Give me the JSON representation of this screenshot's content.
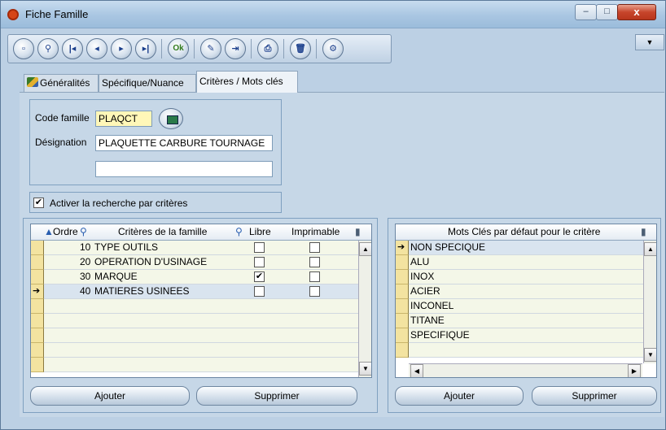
{
  "window": {
    "title": "Fiche Famille",
    "close_glyph": "x",
    "min_glyph": "–",
    "max_glyph": "□"
  },
  "toolbar": {
    "ok_label": "Ok",
    "buttons": [
      "new-icon",
      "search-icon",
      "first-icon",
      "previous-icon",
      "next-icon",
      "last-icon",
      "ok-icon",
      "edit-icon",
      "exit-icon",
      "print-icon",
      "delete-icon",
      "settings-icon"
    ],
    "menu_glyph": "▼"
  },
  "tabs": [
    "Généralités",
    "Spécifique/Nuance",
    "Critères / Mots clés"
  ],
  "form": {
    "code_label": "Code famille",
    "code_value": "PLAQCT",
    "designation_label": "Désignation",
    "designation_value": "PLAQUETTE CARBURE TOURNAGE",
    "extra_value": "",
    "search_checkbox_label": "Activer la recherche par critères",
    "search_checked": true
  },
  "criteria_grid": {
    "headers": {
      "order": "Ordre",
      "criteria": "Critères de la famille",
      "free": "Libre",
      "printable": "Imprimable"
    },
    "rows": [
      {
        "order": "10",
        "name": "TYPE OUTILS",
        "free": false,
        "printable": false
      },
      {
        "order": "20",
        "name": "OPERATION D'USINAGE",
        "free": false,
        "printable": false
      },
      {
        "order": "30",
        "name": "MARQUE",
        "free": true,
        "printable": false
      },
      {
        "order": "40",
        "name": "MATIERES USINEES",
        "free": false,
        "printable": false
      }
    ],
    "selected_row": 3,
    "add_label": "Ajouter",
    "delete_label": "Supprimer"
  },
  "keywords_grid": {
    "header": "Mots Clés par défaut pour le critère",
    "rows": [
      "NON SPECIQUE",
      "ALU",
      "INOX",
      "ACIER",
      "INCONEL",
      "TITANE",
      "SPECIFIQUE"
    ],
    "selected_row": 0,
    "add_label": "Ajouter",
    "delete_label": "Supprimer"
  },
  "glyphs": {
    "row_arrow": "➔",
    "check": "✔",
    "scroll_up": "▲",
    "scroll_down": "▼",
    "scroll_left": "◀",
    "scroll_right": "▶"
  }
}
